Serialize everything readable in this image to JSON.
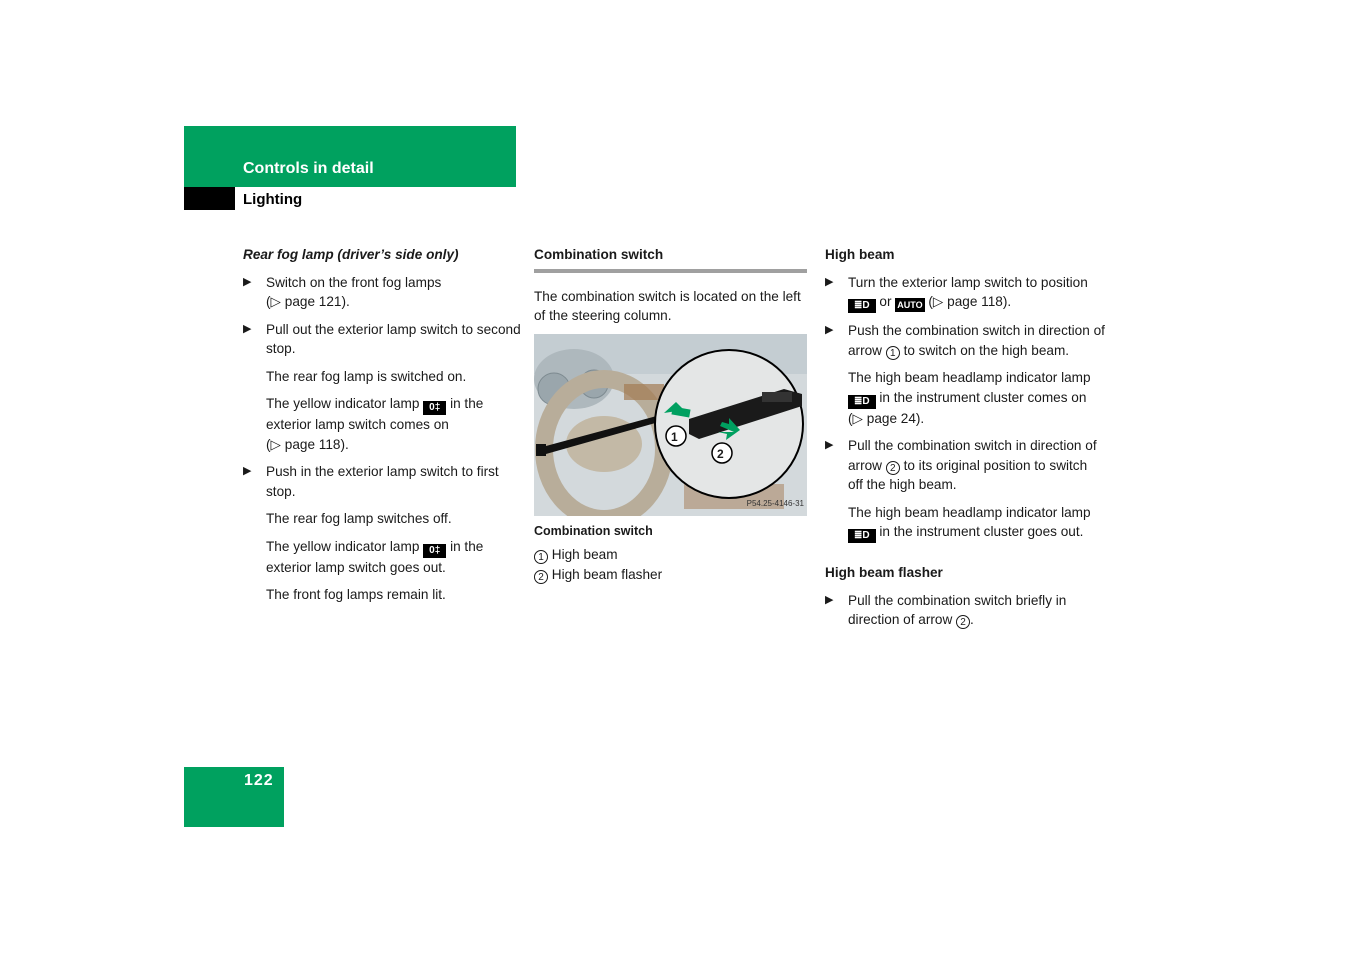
{
  "header": {
    "section": "Controls in detail",
    "subsection": "Lighting"
  },
  "column1": {
    "heading": "Rear fog lamp (driver’s side only)",
    "b1": "Switch on the front fog lamps",
    "b1_ref": "(▷ page 121).",
    "b2": "Pull out the exterior lamp switch to second stop.",
    "p1": "The rear fog lamp is switched on.",
    "p2_a": "The yellow indicator lamp",
    "p2_sym": "0‡",
    "p2_b": "in the exterior lamp switch comes on",
    "p2_ref": "(▷ page 118).",
    "b3": "Push in the exterior lamp switch to first stop.",
    "p3": "The rear fog lamp switches off.",
    "p4_a": "The yellow indicator lamp",
    "p4_sym": "0‡",
    "p4_b": "in the exterior lamp switch goes out.",
    "p5": "The front fog lamps remain lit."
  },
  "column2": {
    "heading": "Combination switch",
    "intro": "The combination switch is located on the left of the steering column.",
    "image": {
      "code": "P54.25-4146-31",
      "label1": "1",
      "label2": "2"
    },
    "caption": "Combination switch",
    "legend": [
      {
        "num": "1",
        "text": "High beam"
      },
      {
        "num": "2",
        "text": "High beam flasher"
      }
    ]
  },
  "column3": {
    "heading1": "High beam",
    "b1_a": "Turn the exterior lamp switch to position",
    "b1_sym1": "≣D",
    "b1_or": "or",
    "b1_sym2": "AUTO",
    "b1_ref": "(▷ page 118).",
    "b2_a": "Push the combination switch in direction of arrow",
    "b2_num": "1",
    "b2_b": "to switch on the high beam.",
    "p1_a": "The high beam headlamp indicator lamp",
    "p1_sym": "≣D",
    "p1_b": "in the instrument cluster comes on (▷ page 24).",
    "b3_a": "Pull the combination switch in direction of arrow",
    "b3_num": "2",
    "b3_b": "to its original position to switch off the high beam.",
    "p2_a": "The high beam headlamp indicator lamp",
    "p2_sym": "≣D",
    "p2_b": "in the instrument cluster goes out.",
    "heading2": "High beam flasher",
    "b4_a": "Pull the combination switch briefly in direction of arrow",
    "b4_num": "2",
    "b4_b": "."
  },
  "footer": {
    "page_number": "122"
  },
  "colors": {
    "brand_green": "#00a15f",
    "arrow_green": "#00a060"
  }
}
